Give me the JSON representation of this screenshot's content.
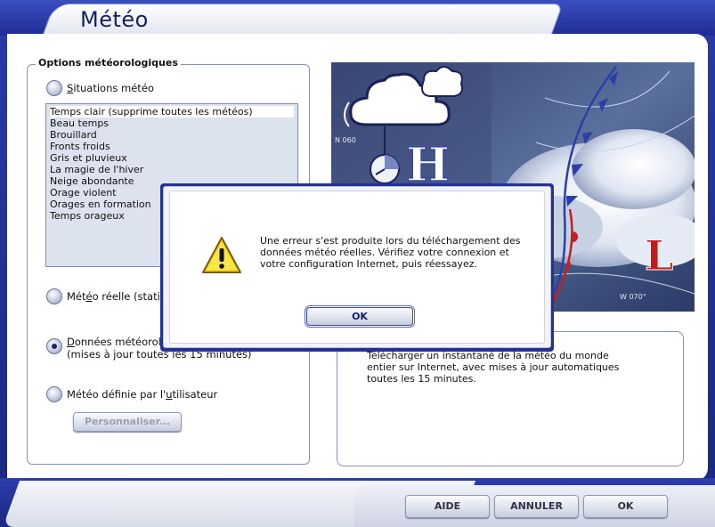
{
  "window": {
    "title": "Météo"
  },
  "options": {
    "group_label": "Options météorologiques",
    "radio_situations": {
      "access_key": "S",
      "rest": "ituations météo"
    },
    "situations_list": [
      "Temps clair (supprime toutes les météos)",
      "Beau temps",
      "Brouillard",
      "Fronts froids",
      "Gris et pluvieux",
      "La magie de l'hiver",
      "Neige abondante",
      "Orage violent",
      "Orages en formation",
      "Temps orageux"
    ],
    "radio_reelle": {
      "pre": "Mét",
      "access_key": "é",
      "rest": "o réelle (statio"
    },
    "radio_donnees": {
      "pre": "",
      "access_key": "D",
      "rest": "onnées météorol",
      "line2": "(mises à jour toutes les 15 minutes)"
    },
    "radio_utilisateur": {
      "pre": "Météo définie par l'",
      "access_key": "u",
      "rest": "tilisateur"
    },
    "personnaliser_label": "Personnaliser..."
  },
  "weather_map": {
    "letter_high": "H",
    "letter_low": "L",
    "label_n": "N 060",
    "label_w": "W 070°"
  },
  "description": "Télécharger un instantané de la météo du monde\nentier sur Internet, avec mises à jour automatiques\ntoutes les 15 minutes.",
  "dialog": {
    "message": "Une erreur s'est produite lors du téléchargement des\ndonnées météo réelles. Vérifiez votre connexion et\nvotre configuration Internet, puis réessayez.",
    "ok_label": "OK"
  },
  "footer": {
    "aide_label": "AIDE",
    "annuler_label": "ANNULER",
    "ok_label": "OK"
  },
  "colors": {
    "frame_blue": "#1e2c94",
    "warning_yellow": "#f4d21a",
    "low_red": "#c41a1a"
  }
}
